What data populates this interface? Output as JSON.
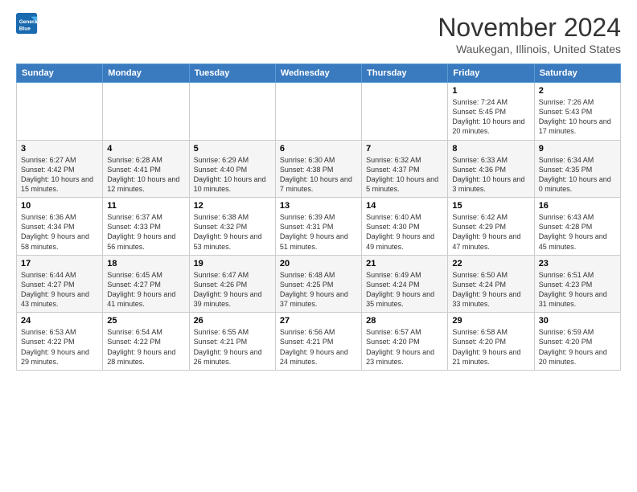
{
  "app": {
    "name": "GeneralBlue",
    "logo_line1": "General",
    "logo_line2": "Blue"
  },
  "title": "November 2024",
  "location": "Waukegan, Illinois, United States",
  "header": {
    "days": [
      "Sunday",
      "Monday",
      "Tuesday",
      "Wednesday",
      "Thursday",
      "Friday",
      "Saturday"
    ]
  },
  "weeks": [
    {
      "cells": [
        {
          "day": null
        },
        {
          "day": null
        },
        {
          "day": null
        },
        {
          "day": null
        },
        {
          "day": null
        },
        {
          "day": "1",
          "sunrise": "Sunrise: 7:24 AM",
          "sunset": "Sunset: 5:45 PM",
          "daylight": "Daylight: 10 hours and 20 minutes."
        },
        {
          "day": "2",
          "sunrise": "Sunrise: 7:26 AM",
          "sunset": "Sunset: 5:43 PM",
          "daylight": "Daylight: 10 hours and 17 minutes."
        }
      ]
    },
    {
      "cells": [
        {
          "day": "3",
          "sunrise": "Sunrise: 6:27 AM",
          "sunset": "Sunset: 4:42 PM",
          "daylight": "Daylight: 10 hours and 15 minutes."
        },
        {
          "day": "4",
          "sunrise": "Sunrise: 6:28 AM",
          "sunset": "Sunset: 4:41 PM",
          "daylight": "Daylight: 10 hours and 12 minutes."
        },
        {
          "day": "5",
          "sunrise": "Sunrise: 6:29 AM",
          "sunset": "Sunset: 4:40 PM",
          "daylight": "Daylight: 10 hours and 10 minutes."
        },
        {
          "day": "6",
          "sunrise": "Sunrise: 6:30 AM",
          "sunset": "Sunset: 4:38 PM",
          "daylight": "Daylight: 10 hours and 7 minutes."
        },
        {
          "day": "7",
          "sunrise": "Sunrise: 6:32 AM",
          "sunset": "Sunset: 4:37 PM",
          "daylight": "Daylight: 10 hours and 5 minutes."
        },
        {
          "day": "8",
          "sunrise": "Sunrise: 6:33 AM",
          "sunset": "Sunset: 4:36 PM",
          "daylight": "Daylight: 10 hours and 3 minutes."
        },
        {
          "day": "9",
          "sunrise": "Sunrise: 6:34 AM",
          "sunset": "Sunset: 4:35 PM",
          "daylight": "Daylight: 10 hours and 0 minutes."
        }
      ]
    },
    {
      "cells": [
        {
          "day": "10",
          "sunrise": "Sunrise: 6:36 AM",
          "sunset": "Sunset: 4:34 PM",
          "daylight": "Daylight: 9 hours and 58 minutes."
        },
        {
          "day": "11",
          "sunrise": "Sunrise: 6:37 AM",
          "sunset": "Sunset: 4:33 PM",
          "daylight": "Daylight: 9 hours and 56 minutes."
        },
        {
          "day": "12",
          "sunrise": "Sunrise: 6:38 AM",
          "sunset": "Sunset: 4:32 PM",
          "daylight": "Daylight: 9 hours and 53 minutes."
        },
        {
          "day": "13",
          "sunrise": "Sunrise: 6:39 AM",
          "sunset": "Sunset: 4:31 PM",
          "daylight": "Daylight: 9 hours and 51 minutes."
        },
        {
          "day": "14",
          "sunrise": "Sunrise: 6:40 AM",
          "sunset": "Sunset: 4:30 PM",
          "daylight": "Daylight: 9 hours and 49 minutes."
        },
        {
          "day": "15",
          "sunrise": "Sunrise: 6:42 AM",
          "sunset": "Sunset: 4:29 PM",
          "daylight": "Daylight: 9 hours and 47 minutes."
        },
        {
          "day": "16",
          "sunrise": "Sunrise: 6:43 AM",
          "sunset": "Sunset: 4:28 PM",
          "daylight": "Daylight: 9 hours and 45 minutes."
        }
      ]
    },
    {
      "cells": [
        {
          "day": "17",
          "sunrise": "Sunrise: 6:44 AM",
          "sunset": "Sunset: 4:27 PM",
          "daylight": "Daylight: 9 hours and 43 minutes."
        },
        {
          "day": "18",
          "sunrise": "Sunrise: 6:45 AM",
          "sunset": "Sunset: 4:27 PM",
          "daylight": "Daylight: 9 hours and 41 minutes."
        },
        {
          "day": "19",
          "sunrise": "Sunrise: 6:47 AM",
          "sunset": "Sunset: 4:26 PM",
          "daylight": "Daylight: 9 hours and 39 minutes."
        },
        {
          "day": "20",
          "sunrise": "Sunrise: 6:48 AM",
          "sunset": "Sunset: 4:25 PM",
          "daylight": "Daylight: 9 hours and 37 minutes."
        },
        {
          "day": "21",
          "sunrise": "Sunrise: 6:49 AM",
          "sunset": "Sunset: 4:24 PM",
          "daylight": "Daylight: 9 hours and 35 minutes."
        },
        {
          "day": "22",
          "sunrise": "Sunrise: 6:50 AM",
          "sunset": "Sunset: 4:24 PM",
          "daylight": "Daylight: 9 hours and 33 minutes."
        },
        {
          "day": "23",
          "sunrise": "Sunrise: 6:51 AM",
          "sunset": "Sunset: 4:23 PM",
          "daylight": "Daylight: 9 hours and 31 minutes."
        }
      ]
    },
    {
      "cells": [
        {
          "day": "24",
          "sunrise": "Sunrise: 6:53 AM",
          "sunset": "Sunset: 4:22 PM",
          "daylight": "Daylight: 9 hours and 29 minutes."
        },
        {
          "day": "25",
          "sunrise": "Sunrise: 6:54 AM",
          "sunset": "Sunset: 4:22 PM",
          "daylight": "Daylight: 9 hours and 28 minutes."
        },
        {
          "day": "26",
          "sunrise": "Sunrise: 6:55 AM",
          "sunset": "Sunset: 4:21 PM",
          "daylight": "Daylight: 9 hours and 26 minutes."
        },
        {
          "day": "27",
          "sunrise": "Sunrise: 6:56 AM",
          "sunset": "Sunset: 4:21 PM",
          "daylight": "Daylight: 9 hours and 24 minutes."
        },
        {
          "day": "28",
          "sunrise": "Sunrise: 6:57 AM",
          "sunset": "Sunset: 4:20 PM",
          "daylight": "Daylight: 9 hours and 23 minutes."
        },
        {
          "day": "29",
          "sunrise": "Sunrise: 6:58 AM",
          "sunset": "Sunset: 4:20 PM",
          "daylight": "Daylight: 9 hours and 21 minutes."
        },
        {
          "day": "30",
          "sunrise": "Sunrise: 6:59 AM",
          "sunset": "Sunset: 4:20 PM",
          "daylight": "Daylight: 9 hours and 20 minutes."
        }
      ]
    }
  ]
}
